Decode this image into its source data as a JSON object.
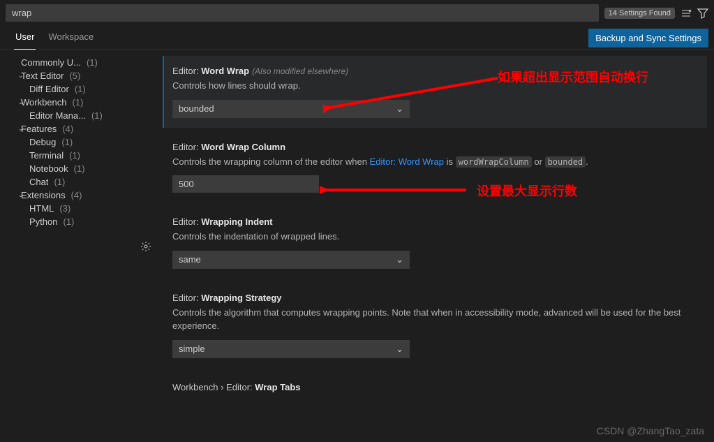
{
  "search": {
    "value": "wrap",
    "count_badge": "14 Settings Found"
  },
  "tabs": {
    "user": "User",
    "workspace": "Workspace"
  },
  "sync_button": "Backup and Sync Settings",
  "sidebar": {
    "items": [
      {
        "label": "Commonly U...",
        "count": "(1)",
        "chev": ""
      },
      {
        "label": "Text Editor",
        "count": "(5)",
        "chev": "v"
      },
      {
        "label": "Diff Editor",
        "count": "(1)",
        "child": true
      },
      {
        "label": "Workbench",
        "count": "(1)",
        "chev": "v"
      },
      {
        "label": "Editor Mana...",
        "count": "(1)",
        "child": true
      },
      {
        "label": "Features",
        "count": "(4)",
        "chev": "v"
      },
      {
        "label": "Debug",
        "count": "(1)",
        "child": true
      },
      {
        "label": "Terminal",
        "count": "(1)",
        "child": true
      },
      {
        "label": "Notebook",
        "count": "(1)",
        "child": true
      },
      {
        "label": "Chat",
        "count": "(1)",
        "child": true
      },
      {
        "label": "Extensions",
        "count": "(4)",
        "chev": "v"
      },
      {
        "label": "HTML",
        "count": "(3)",
        "child": true
      },
      {
        "label": "Python",
        "count": "(1)",
        "child": true
      }
    ]
  },
  "settings": {
    "wordWrap": {
      "cat": "Editor:",
      "name": "Word Wrap",
      "modified": "(Also modified elsewhere)",
      "desc": "Controls how lines should wrap.",
      "value": "bounded"
    },
    "wordWrapColumn": {
      "cat": "Editor:",
      "name": "Word Wrap Column",
      "desc_pre": "Controls the wrapping column of the editor when ",
      "desc_link": "Editor: Word Wrap",
      "desc_mid": " is ",
      "code1": "wordWrapColumn",
      "or": " or ",
      "code2": "bounded",
      "dot": ".",
      "value": "500"
    },
    "wrappingIndent": {
      "cat": "Editor:",
      "name": "Wrapping Indent",
      "desc": "Controls the indentation of wrapped lines.",
      "value": "same"
    },
    "wrappingStrategy": {
      "cat": "Editor:",
      "name": "Wrapping Strategy",
      "desc": "Controls the algorithm that computes wrapping points. Note that when in accessibility mode, advanced will be used for the best experience.",
      "value": "simple"
    },
    "wrapTabs": {
      "cat": "Workbench › Editor:",
      "name": "Wrap Tabs"
    }
  },
  "annotations": {
    "a1": "如果超出显示范围自动换行",
    "a2": "设置最大显示行数"
  },
  "watermark": "CSDN @ZhangTao_zata"
}
